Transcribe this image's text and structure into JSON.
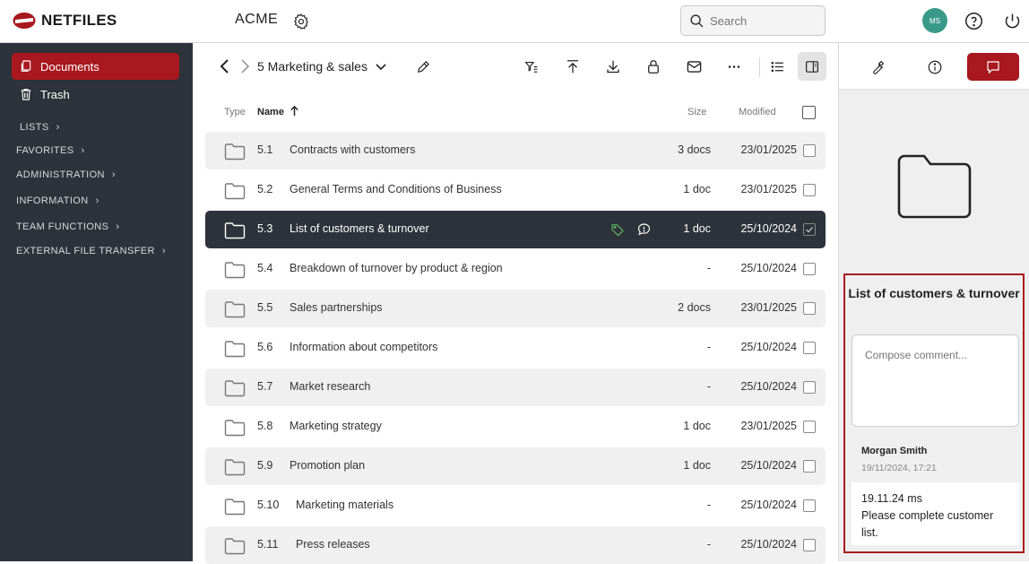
{
  "app": {
    "logo_text": "NETFILES",
    "org_name": "ACME",
    "brand_color": "#a8181e"
  },
  "search": {
    "placeholder": "Search"
  },
  "user": {
    "initials": "MS"
  },
  "sidebar": {
    "items": [
      {
        "label": "Documents",
        "icon": "documents-icon",
        "active": true
      },
      {
        "label": "Trash",
        "icon": "trash-icon",
        "active": false
      }
    ],
    "sections": [
      "LISTS",
      "FAVORITES",
      "ADMINISTRATION",
      "INFORMATION",
      "TEAM FUNCTIONS",
      "EXTERNAL FILE TRANSFER"
    ]
  },
  "breadcrumb": {
    "current": "5 Marketing & sales"
  },
  "list": {
    "headers": {
      "type": "Type",
      "name": "Name",
      "size": "Size",
      "modified": "Modified"
    },
    "rows": [
      {
        "num": "5.1",
        "name": "Contracts with customers",
        "size": "3 docs",
        "modified": "23/01/2025",
        "selected": false
      },
      {
        "num": "5.2",
        "name": "General Terms and Conditions of Business",
        "size": "1 doc",
        "modified": "23/01/2025",
        "selected": false
      },
      {
        "num": "5.3",
        "name": "List of customers & turnover",
        "size": "1 doc",
        "modified": "25/10/2024",
        "selected": true
      },
      {
        "num": "5.4",
        "name": "Breakdown of turnover by product & region",
        "size": "-",
        "modified": "25/10/2024",
        "selected": false
      },
      {
        "num": "5.5",
        "name": "Sales partnerships",
        "size": "2 docs",
        "modified": "23/01/2025",
        "selected": false
      },
      {
        "num": "5.6",
        "name": "Information about competitors",
        "size": "-",
        "modified": "25/10/2024",
        "selected": false
      },
      {
        "num": "5.7",
        "name": "Market research",
        "size": "-",
        "modified": "25/10/2024",
        "selected": false
      },
      {
        "num": "5.8",
        "name": "Marketing strategy",
        "size": "1 doc",
        "modified": "23/01/2025",
        "selected": false
      },
      {
        "num": "5.9",
        "name": "Promotion plan",
        "size": "1 doc",
        "modified": "25/10/2024",
        "selected": false
      },
      {
        "num": "5.10",
        "name": "Marketing materials",
        "size": "-",
        "modified": "25/10/2024",
        "selected": false
      },
      {
        "num": "5.11",
        "name": "Press releases",
        "size": "-",
        "modified": "25/10/2024",
        "selected": false
      }
    ]
  },
  "panel": {
    "title": "List of customers & turnover",
    "compose_placeholder": "Compose comment...",
    "comment": {
      "author": "Morgan Smith",
      "timestamp": "19/11/2024, 17:21",
      "line1": "19.11.24 ms",
      "line2": "Please complete customer list."
    }
  }
}
